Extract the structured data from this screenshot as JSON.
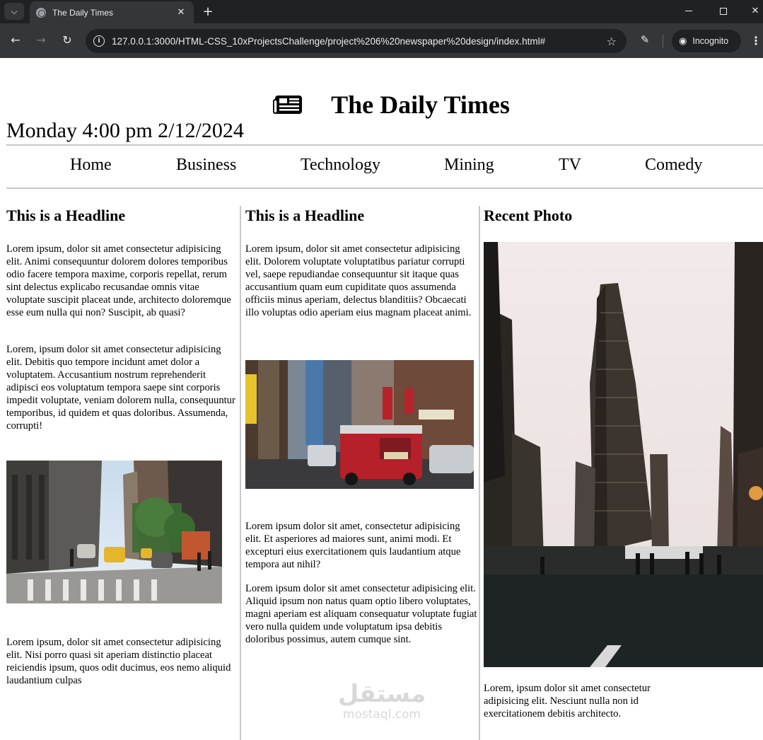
{
  "browser": {
    "tab_title": "The Daily Times",
    "url": "127.0.0.1:3000/HTML-CSS_10xProjectsChallenge/project%206%20newspaper%20design/index.html#",
    "profile_label": "Incognito",
    "icons": [
      "tab-list-icon",
      "globe-icon",
      "close-icon",
      "plus-icon",
      "minimize-icon",
      "maximize-icon",
      "close-window-icon",
      "back-arrow-icon",
      "forward-arrow-icon",
      "reload-icon",
      "site-info-icon",
      "star-icon",
      "extensions-icon",
      "incognito-icon",
      "kebab-menu-icon"
    ]
  },
  "header": {
    "title": "The Daily Times",
    "dateline": "Monday 4:00 pm 2/12/2024",
    "icon": "newspaper-icon"
  },
  "nav": {
    "items": [
      "Home",
      "Business",
      "Technology",
      "Mining",
      "TV",
      "Comedy"
    ]
  },
  "columns": [
    {
      "headline": "This is a Headline",
      "paragraphs": [
        "Lorem ipsum, dolor sit amet consectetur adipisicing elit. Animi consequuntur dolorem dolores temporibus odio facere tempora maxime, corporis repellat, rerum sint delectus explicabo recusandae omnis vitae voluptate suscipit placeat unde, architecto doloremque esse eum nulla qui non? Suscipit, ab quasi?",
        "Lorem, ipsum dolor sit amet consectetur adipisicing elit. Debitis quo tempore incidunt amet dolor a voluptatem. Accusantium nostrum reprehenderit adipisci eos voluptatum tempora saepe sint corporis impedit voluptate, veniam dolorem nulla, consequuntur temporibus, id quidem et quas doloribus. Assumenda, corrupti!",
        "Lorem ipsum, dolor sit amet consectetur adipisicing elit. Nisi porro quasi sit aperiam distinctio placeat reiciendis ipsum, quos odit ducimus, eos nemo aliquid laudantium culpas"
      ],
      "photo": "city-street-crosswalk-photo"
    },
    {
      "headline": "This is a Headline",
      "paragraphs": [
        "Lorem ipsum, dolor sit amet consectetur adipisicing elit. Dolorem voluptate voluptatibus pariatur corrupti vel, saepe repudiandae consequuntur sit itaque quas accusantium quam eum cupiditate quos assumenda officiis minus aperiam, delectus blanditiis? Obcaecati illo voluptas odio aperiam eius magnam placeat animi.",
        "Lorem ipsum dolor sit amet, consectetur adipisicing elit. Et asperiores ad maiores sunt, animi modi. Et excepturi eius exercitationem quis laudantium atque tempora aut nihil?",
        "Lorem ipsum dolor sit amet consectetur adipisicing elit. Aliquid ipsum non natus quam optio libero voluptates, magni aperiam est aliquam consequatur voluptate fugiat vero nulla quidem unde voluptatum ipsa debitis doloribus possimus, autem cumque sint."
      ],
      "photo": "fire-truck-street-photo"
    },
    {
      "headline": "Recent Photo",
      "paragraphs": [
        "Lorem, ipsum dolor sit amet consectetur adipisicing elit. Nesciunt nulla non id exercitationem debitis architecto."
      ],
      "photo": "flatiron-building-photo"
    }
  ],
  "watermark": {
    "arabic": "مستقل",
    "latin": "mostaql.com"
  }
}
